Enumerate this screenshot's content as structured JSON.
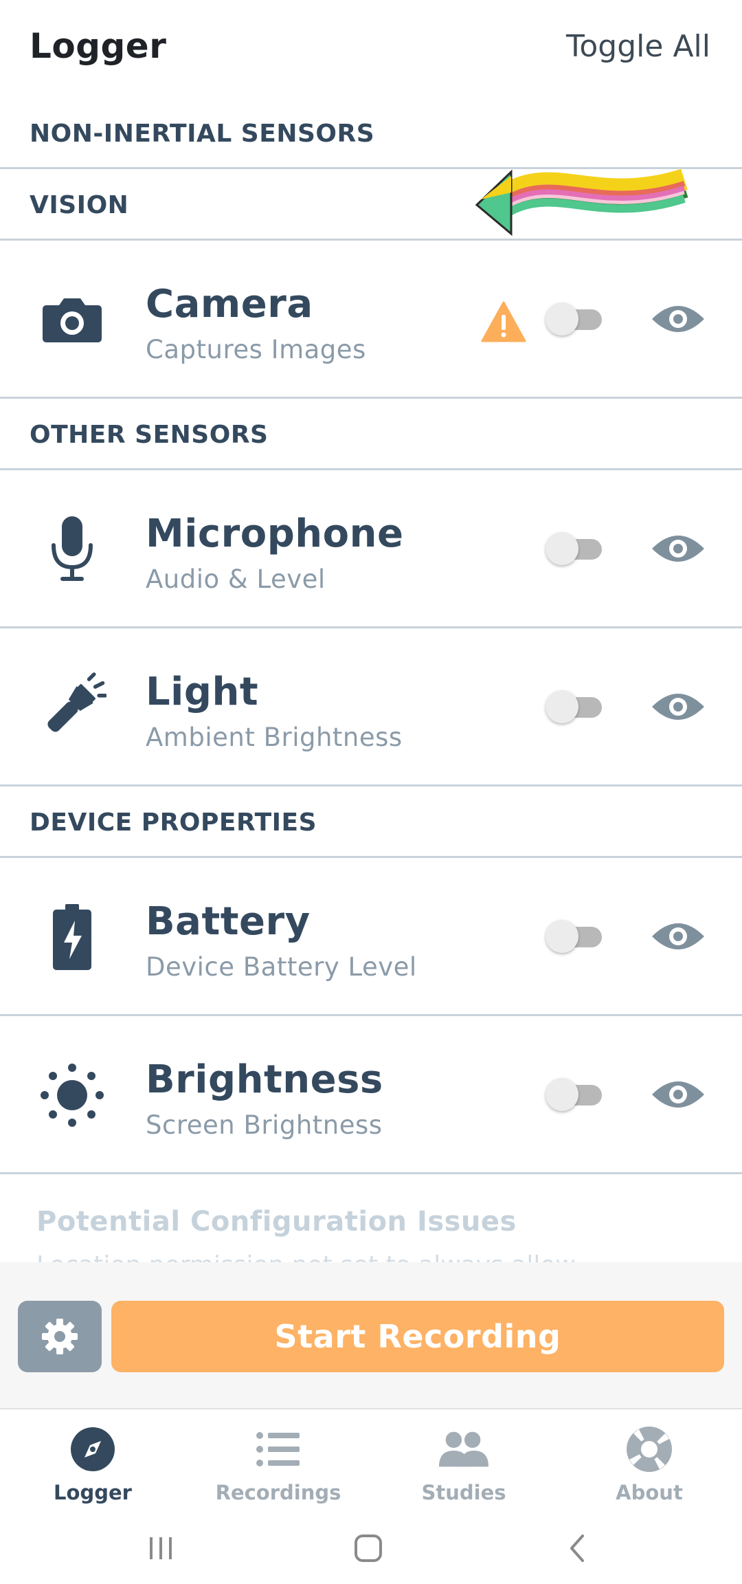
{
  "header": {
    "title": "Logger",
    "toggle_all": "Toggle All"
  },
  "sections": {
    "non_inertial": "NON-INERTIAL SENSORS",
    "vision": "VISION",
    "other": "OTHER SENSORS",
    "device": "DEVICE PROPERTIES"
  },
  "sensors": [
    {
      "icon": "camera-icon",
      "title": "Camera",
      "subtitle": "Captures Images",
      "enabled": false,
      "warning": true
    },
    {
      "icon": "microphone-icon",
      "title": "Microphone",
      "subtitle": "Audio & Level",
      "enabled": false,
      "warning": false
    },
    {
      "icon": "flashlight-icon",
      "title": "Light",
      "subtitle": "Ambient Brightness",
      "enabled": false,
      "warning": false
    },
    {
      "icon": "battery-icon",
      "title": "Battery",
      "subtitle": "Device Battery Level",
      "enabled": false,
      "warning": false
    },
    {
      "icon": "sun-icon",
      "title": "Brightness",
      "subtitle": "Screen Brightness",
      "enabled": false,
      "warning": false
    }
  ],
  "issues": {
    "title": "Potential Configuration Issues",
    "text": "Location permission not set to always allow"
  },
  "actions": {
    "settings_icon": "gear-icon",
    "start_recording": "Start Recording"
  },
  "tabs": [
    {
      "icon": "compass-icon",
      "label": "Logger",
      "active": true
    },
    {
      "icon": "list-icon",
      "label": "Recordings",
      "active": false
    },
    {
      "icon": "users-icon",
      "label": "Studies",
      "active": false
    },
    {
      "icon": "lifebuoy-icon",
      "label": "About",
      "active": false
    }
  ],
  "colors": {
    "accent_orange": "#fdb265",
    "text_dark": "#34495e",
    "text_muted": "#8a9aa8",
    "divider": "#c9d2da",
    "warning": "#fdae5b",
    "settings_button": "#8b9ba8"
  }
}
